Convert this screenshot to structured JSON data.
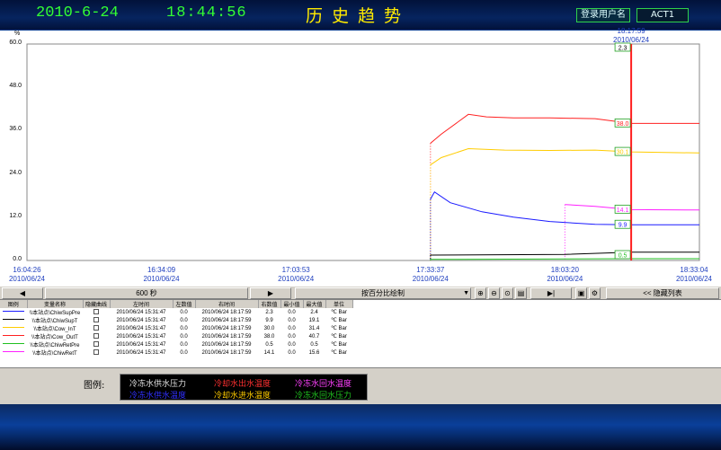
{
  "header": {
    "date": "2010-6-24",
    "time": "18:44:56",
    "title": "历史趋势",
    "login_button": "登录用户名",
    "user": "ACT1"
  },
  "trend": {
    "y_unit": "%",
    "y_ticks": [
      "60.0",
      "48.0",
      "36.0",
      "24.0",
      "12.0",
      "0.0"
    ],
    "x_ticks": [
      {
        "time": "16:04:26",
        "date": "2010/06/24"
      },
      {
        "time": "16:34:09",
        "date": "2010/06/24"
      },
      {
        "time": "17:03:53",
        "date": "2010/06/24"
      },
      {
        "time": "17:33:37",
        "date": "2010/06/24"
      },
      {
        "time": "18:03:20",
        "date": "2010/06/24"
      },
      {
        "time": "18:33:04",
        "date": "2010/06/24"
      }
    ],
    "cursor": {
      "time": "18:17:59",
      "date": "2010/06/24"
    },
    "cursor_labels": [
      "2.3",
      "38.0",
      "30.1",
      "14.1",
      "9.9",
      "0.5"
    ]
  },
  "toolbar": {
    "span": "600 秒",
    "mode": "按百分比绘制",
    "hide_list": "<< 隐藏列表"
  },
  "table": {
    "headers": [
      "图例",
      "变量名称",
      "隐藏曲线",
      "左时间",
      "左数值",
      "右时间",
      "右数值",
      "最小值",
      "最大值",
      "单位"
    ],
    "rows": [
      {
        "color": "#1a1aff",
        "name": "\\\\本站点\\ChiwSupPre",
        "lt": "2010/06/24 15:31:47",
        "lv": "0.0",
        "rt": "2010/06/24 18:17:59",
        "rv": "2.3",
        "min": "0.0",
        "max": "2.4",
        "unit": "℃ Bar"
      },
      {
        "color": "#000000",
        "name": "\\\\本站点\\ChiwSupT",
        "lt": "2010/06/24 15:31:47",
        "lv": "0.0",
        "rt": "2010/06/24 18:17:59",
        "rv": "9.9",
        "min": "0.0",
        "max": "19.1",
        "unit": "℃ Bar"
      },
      {
        "color": "#ffcc00",
        "name": "\\\\本站点\\Cow_InT",
        "lt": "2010/06/24 15:31:47",
        "lv": "0.0",
        "rt": "2010/06/24 18:17:59",
        "rv": "30.0",
        "min": "0.0",
        "max": "31.4",
        "unit": "℃ Bar"
      },
      {
        "color": "#ff2020",
        "name": "\\\\本站点\\Cow_OutT",
        "lt": "2010/06/24 15:31:47",
        "lv": "0.0",
        "rt": "2010/06/24 18:17:59",
        "rv": "38.0",
        "min": "0.0",
        "max": "40.7",
        "unit": "℃ Bar"
      },
      {
        "color": "#20c020",
        "name": "\\\\本站点\\ChiwRetPre",
        "lt": "2010/06/24 15:31:47",
        "lv": "0.0",
        "rt": "2010/06/24 18:17:59",
        "rv": "0.5",
        "min": "0.0",
        "max": "0.5",
        "unit": "℃ Bar"
      },
      {
        "color": "#ff20ff",
        "name": "\\\\本站点\\ChiwRetT",
        "lt": "2010/06/24 15:31:47",
        "lv": "0.0",
        "rt": "2010/06/24 18:17:59",
        "rv": "14.1",
        "min": "0.0",
        "max": "15.6",
        "unit": "℃ Bar"
      }
    ]
  },
  "legend": {
    "label": "图例:",
    "items": [
      {
        "text": "冷冻水供水压力",
        "color": "#e0e0e0"
      },
      {
        "text": "冷却水出水温度",
        "color": "#ff3030"
      },
      {
        "text": "冷冻水回水温度",
        "color": "#ff40ff"
      },
      {
        "text": "冷冻水供水温度",
        "color": "#3030ff"
      },
      {
        "text": "冷却水进水温度",
        "color": "#ffcc00"
      },
      {
        "text": "冷冻水回水压力",
        "color": "#20c020"
      }
    ]
  },
  "chart_data": {
    "type": "line",
    "ylim": [
      0,
      60
    ],
    "y_unit": "%",
    "x_range": [
      "16:04:26",
      "18:33:04"
    ],
    "series": [
      {
        "color": "#ff2020",
        "x": [
          "17:33:37",
          "17:36:00",
          "17:42:00",
          "17:46:00",
          "17:52:00",
          "18:00:00",
          "18:10:00",
          "18:17:59",
          "18:33:04"
        ],
        "values": [
          32.5,
          35,
          40.5,
          39.8,
          39.5,
          39.5,
          39.3,
          38.0,
          38.0
        ]
      },
      {
        "color": "#ffcc00",
        "x": [
          "17:33:37",
          "17:36:00",
          "17:42:00",
          "17:50:00",
          "18:00:00",
          "18:10:00",
          "18:17:59",
          "18:33:04"
        ],
        "values": [
          26.5,
          28.5,
          31.0,
          30.6,
          30.5,
          30.6,
          30.1,
          29.8
        ]
      },
      {
        "color": "#ff20ff",
        "x": [
          "18:03:20",
          "18:10:00",
          "18:17:59",
          "18:33:04"
        ],
        "values": [
          15.5,
          15.0,
          14.1,
          14.0
        ]
      },
      {
        "color": "#1a1aff",
        "x": [
          "17:33:37",
          "17:34:30",
          "17:38:00",
          "17:45:00",
          "17:52:00",
          "18:00:00",
          "18:10:00",
          "18:17:59",
          "18:33:04"
        ],
        "values": [
          17.0,
          19.0,
          16.0,
          13.5,
          12.0,
          10.8,
          10.0,
          9.9,
          9.9
        ]
      },
      {
        "color": "#000000",
        "x": [
          "17:33:37",
          "18:03:20",
          "18:17:59",
          "18:33:04"
        ],
        "values": [
          1.5,
          1.7,
          2.3,
          2.3
        ]
      },
      {
        "color": "#20c020",
        "x": [
          "17:33:37",
          "18:17:59",
          "18:33:04"
        ],
        "values": [
          0.3,
          0.5,
          0.5
        ]
      }
    ]
  }
}
